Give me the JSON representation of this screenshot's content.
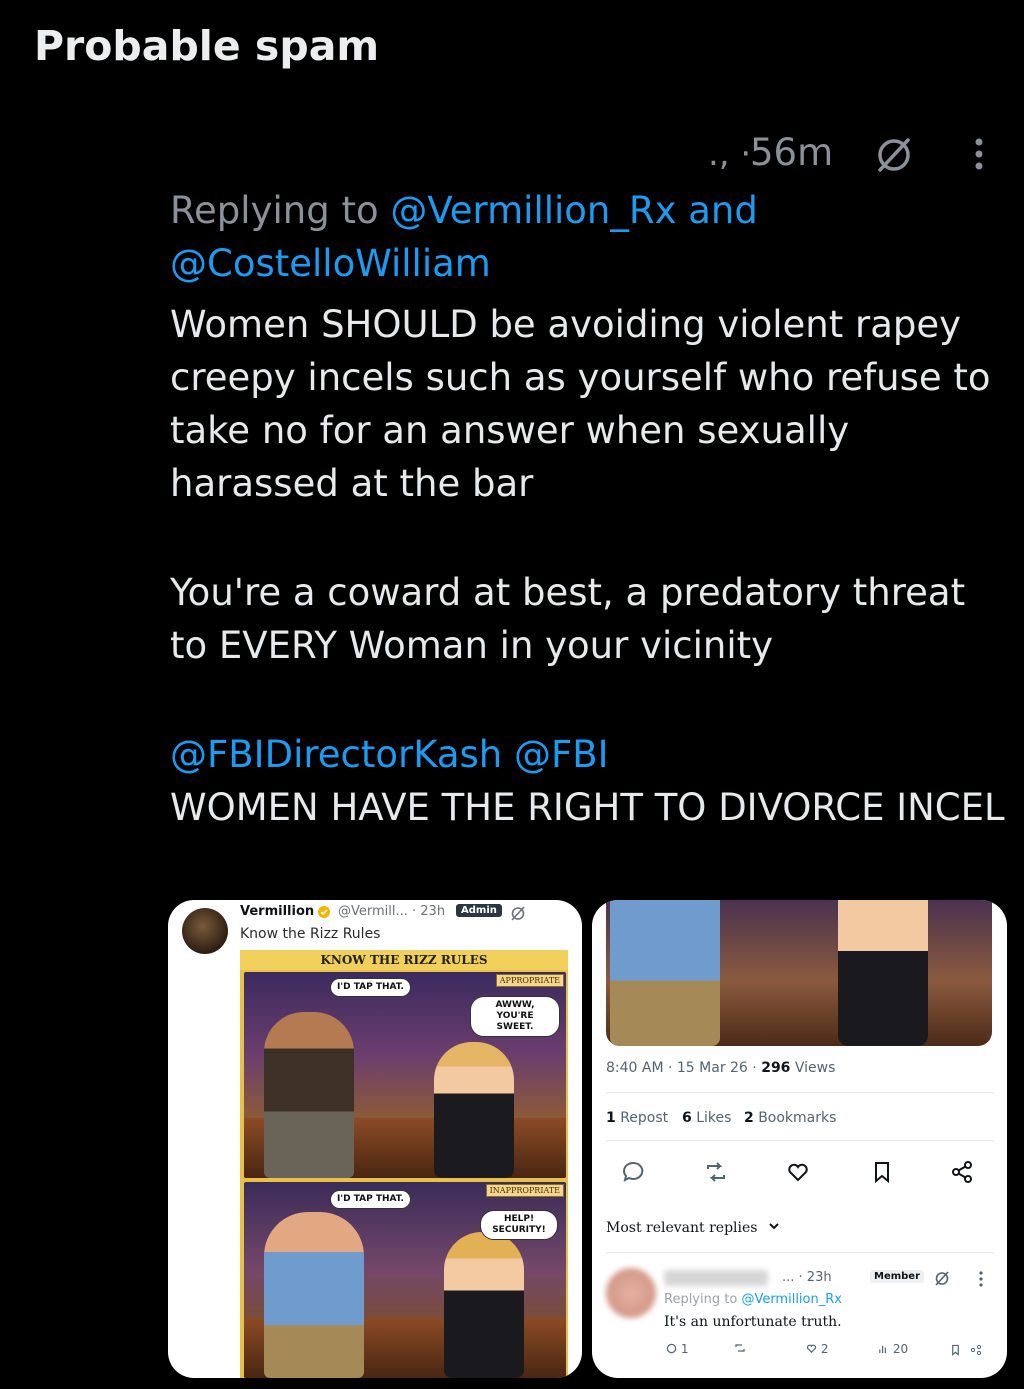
{
  "section_title": "Probable spam",
  "tweet": {
    "leading_dots": "., ·",
    "time": "56m",
    "replying_prefix": "Replying to ",
    "replying_user1": "@Vermillion_Rx",
    "replying_and": "and",
    "replying_user2": "@CostelloWilliam",
    "paragraph1": "Women SHOULD be avoiding violent rapey creepy incels such as yourself who refuse to take no for an answer when sexually harassed at the bar",
    "paragraph2": "You're a coward at best, a predatory threat to EVERY Woman in your vicinity",
    "mentions": "@FBIDirectorKash @FBI",
    "paragraph3": "WOMEN HAVE THE RIGHT TO DIVORCE INCEL"
  },
  "embed_left": {
    "name": "Vermillion",
    "handle_time": "@Vermill... · 23h",
    "badge": "Admin",
    "subtitle": "Know the Rizz Rules",
    "comic_title": "KNOW THE RIZZ RULES",
    "tag_top": "APPROPRIATE",
    "bubble1": "I'D TAP THAT.",
    "bubble2": "AWWW, YOU'RE SWEET.",
    "tag_bottom": "INAPPROPRIATE",
    "bubble3": "I'D TAP THAT.",
    "bubble4": "HELP! SECURITY!"
  },
  "embed_right": {
    "timestamp": "8:40 AM · 15 Mar 26 · ",
    "views_count": "296",
    "views_label": " Views",
    "reposts_count": "1",
    "reposts_label": " Repost",
    "likes_count": "6",
    "likes_label": " Likes",
    "bookmarks_count": "2",
    "bookmarks_label": " Bookmarks",
    "most_relevant": "Most relevant replies",
    "reply": {
      "meta": "... · 23h",
      "badge": "Member",
      "replying_prefix": "Replying to ",
      "replying_user": "@Vermillion_Rx",
      "text": "It's an unfortunate truth.",
      "comments": "1",
      "likes": "2",
      "views": "20"
    }
  },
  "colors": {
    "background": "#000000",
    "text": "#e7e9ea",
    "muted": "#8b9198",
    "link": "#1d9bf0"
  }
}
